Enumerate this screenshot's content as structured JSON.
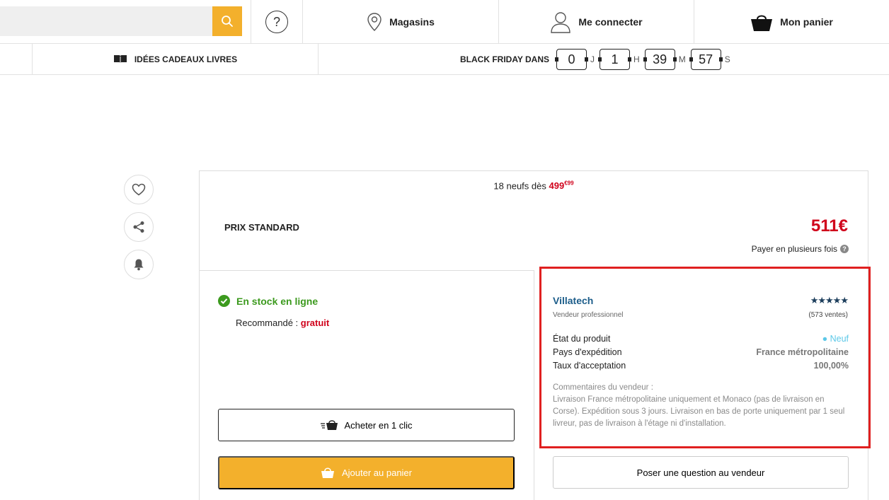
{
  "header": {
    "search": {
      "placeholder": ""
    },
    "help": {
      "glyph": "?"
    },
    "stores_label": "Magasins",
    "login_label": "Me connecter",
    "cart_label": "Mon panier"
  },
  "subnav": {
    "gift_label": "IDÉES CADEAUX LIVRES",
    "black_friday": {
      "label": "BLACK FRIDAY DANS",
      "days": "0",
      "days_unit": "J",
      "hours": "1",
      "hours_unit": "H",
      "minutes": "39",
      "minutes_unit": "M",
      "seconds": "57",
      "seconds_unit": "S"
    }
  },
  "side_actions": [
    "heart-icon",
    "share-icon",
    "bell-icon"
  ],
  "offer": {
    "offers_text": "18 neufs dès",
    "offers_price": "499",
    "offers_price_cents": "€99",
    "standard_label": "PRIX STANDARD",
    "price": "511€",
    "pay_multiple": "Payer en plusieurs fois",
    "stock_label": "En stock en ligne",
    "recommended_label": "Recommandé :",
    "recommended_value": "gratuit",
    "buy_1click": "Acheter en 1 clic",
    "add_to_cart": "Ajouter au panier"
  },
  "seller": {
    "name": "Villatech",
    "type": "Vendeur professionnel",
    "rating": 4.5,
    "stars": "★★★★★",
    "sales": "(573 ventes)",
    "rows": [
      {
        "label": "État du produit",
        "value": "● Neuf"
      },
      {
        "label": "Pays d'expédition",
        "value": "France métropolitaine"
      },
      {
        "label": "Taux d'acceptation",
        "value": "100,00%"
      }
    ],
    "comments_title": "Commentaires du vendeur :",
    "comments": "Livraison France métropolitaine uniquement et Monaco (pas de livraison en Corse). Expédition sous 3 jours. Livraison en bas de porte uniquement par 1 seul livreur, pas de livraison à l'étage ni d'installation.",
    "ask_button": "Poser une question au vendeur"
  },
  "colors": {
    "accent": "#f3b02c",
    "price_red": "#d0021b",
    "stock_green": "#3c9a1e",
    "seller_blue": "#1c5d8a",
    "highlight_red": "#e02020"
  }
}
